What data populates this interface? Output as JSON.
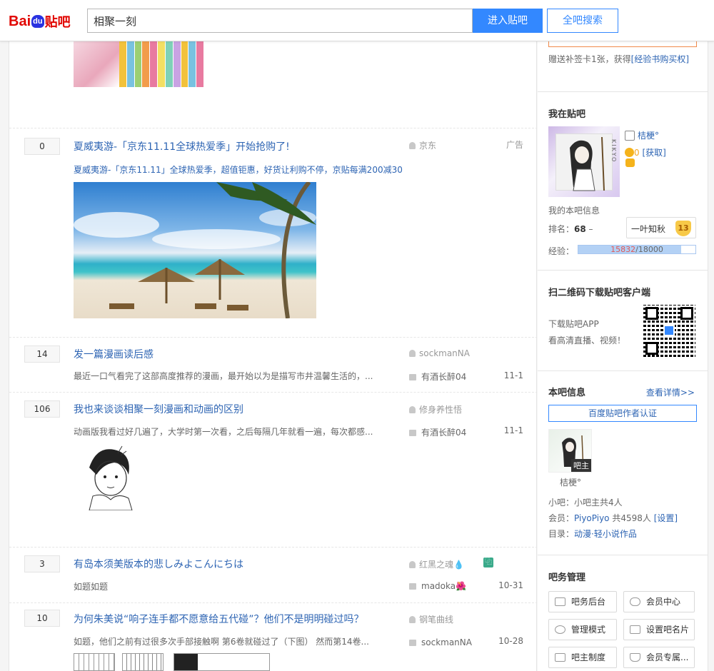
{
  "header": {
    "logo_text": "贴吧",
    "logo_bai": "Bai",
    "logo_du": "du",
    "search_value": "相聚一刻",
    "enter_button": "进入贴吧",
    "all_search_button": "全吧搜索"
  },
  "threads": [
    {
      "replies": "0",
      "title": "夏威夷游-「京东11.11全球热爱季」开始抢购了!",
      "abstract": "夏威夷游-「京东11.11」全球热爱季，超值钜惠，好货让利购不停，京贴每满200减30",
      "author": "京东",
      "ad_label": "广告"
    },
    {
      "replies": "14",
      "title": "发一篇漫画读后感",
      "abstract": "最近一口气看完了这部高度推荐的漫画，最开始以为是描写市井温馨生活的，...",
      "author": "sockmanNA",
      "last_reply": "有酒长醉04",
      "time": "11-1"
    },
    {
      "replies": "106",
      "title": "我也来谈谈相聚一刻漫画和动画的区别",
      "abstract": "动画版我看过好几遍了，大学时第一次看，之后每隔几年就看一遍，每次都感...",
      "author": "修身养性悟",
      "last_reply": "有酒长醉04",
      "time": "11-1"
    },
    {
      "replies": "3",
      "title": "有岛本须美版本的悲しみよこんにちは",
      "abstract": "如题如题",
      "author": "红黑之魂💧",
      "last_reply": "madoka🌺",
      "time": "10-31",
      "badge": "⿻"
    },
    {
      "replies": "10",
      "title": "为何朱美说“响子连手都不愿意给五代碰”？他们不是明明碰过吗？",
      "abstract": "如题，他们之前有过很多次手部接触啊 第6卷就碰过了（下图） 然而第14卷...",
      "author": "钢笔曲线",
      "last_reply": "sockmanNA",
      "time": "10-28"
    }
  ],
  "aside": {
    "sign_note": "赠送补签卡1张，获得",
    "sign_link": "[经验书购买权]",
    "my_tieba_title": "我在贴吧",
    "username": "桔梗°",
    "tdou": "0",
    "get_link": "[获取]",
    "my_info": "我的本吧信息",
    "rank_label": "排名：",
    "rank_value": "68",
    "rank_trend": "–",
    "level_name": "一叶知秋",
    "level_num": "13",
    "exp_label": "经验：",
    "exp_current": "15832",
    "exp_total": "/18000",
    "exp_fraction": 0.88,
    "qr_title": "扫二维码下载贴吧客户端",
    "qr_line1": "下载贴吧APP",
    "qr_line2": "看高清直播、视频！",
    "info_title": "本吧信息",
    "info_more": "查看详情>>",
    "author_cert": "百度贴吧作者认证",
    "owner_tag": "吧主",
    "owner_name": "桔梗°",
    "small_owner": "小吧：小吧主共4人",
    "members_label": "会员：",
    "members_name": "PiyoPiyo",
    "members_count": "共4598人",
    "members_set": "[设置]",
    "catalog_label": "目录：",
    "catalog_value": "动漫·轻小说作品",
    "mgmt_title": "吧务管理",
    "mgmt_buttons": [
      "吧务后台",
      "会员中心",
      "管理模式",
      "设置吧名片",
      "吧主制度",
      "会员专属..."
    ],
    "cover_text": "KIKYO"
  },
  "colors": {
    "accent": "#3388ff",
    "link": "#2d64b3",
    "red": "#e10601"
  }
}
